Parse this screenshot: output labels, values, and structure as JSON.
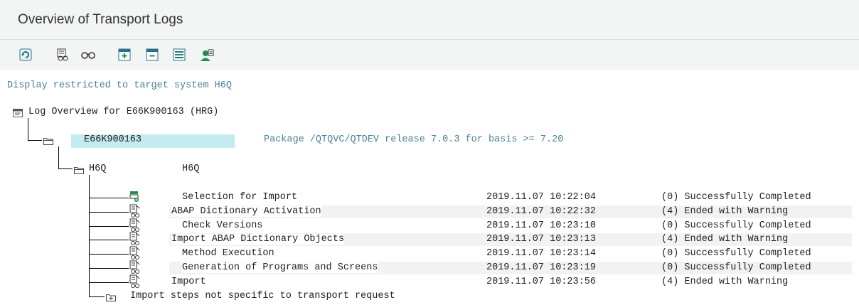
{
  "window": {
    "title": "Overview of Transport Logs"
  },
  "toolbar": {
    "buttons": [
      {
        "name": "refresh-icon"
      },
      {
        "name": "display-logs-icon"
      },
      {
        "name": "glasses-icon"
      },
      {
        "name": "expand-icon"
      },
      {
        "name": "collapse-icon"
      },
      {
        "name": "expand-subtree-icon"
      },
      {
        "name": "user-settings-icon"
      }
    ]
  },
  "restriction": "Display restricted to target system H6Q",
  "tree": {
    "root": {
      "label": "Log Overview for E66K900163 (HRG)"
    },
    "request": {
      "id": "E66K900163",
      "description": "Package /QTQVC/QTDEV release 7.0.3 for basis >= 7.20"
    },
    "system": {
      "id": "H6Q",
      "name": "H6Q"
    },
    "steps": [
      {
        "name": "Selection for Import",
        "datetime": "2019.11.07 10:22:04",
        "status": "(0) Successfully Completed"
      },
      {
        "name": "ABAP Dictionary Activation",
        "datetime": "2019.11.07 10:22:32",
        "status": "(4) Ended with Warning"
      },
      {
        "name": "Check Versions",
        "datetime": "2019.11.07 10:23:10",
        "status": "(0) Successfully Completed"
      },
      {
        "name": "Import ABAP Dictionary Objects",
        "datetime": "2019.11.07 10:23:13",
        "status": "(4) Ended with Warning"
      },
      {
        "name": "Method Execution",
        "datetime": "2019.11.07 10:23:14",
        "status": "(0) Successfully Completed"
      },
      {
        "name": "Generation of Programs and Screens",
        "datetime": "2019.11.07 10:23:19",
        "status": "(0) Successfully Completed"
      },
      {
        "name": "Import",
        "datetime": "2019.11.07 10:23:56",
        "status": "(4) Ended with Warning"
      }
    ],
    "other": {
      "label": "Import steps not specific to transport request"
    }
  }
}
